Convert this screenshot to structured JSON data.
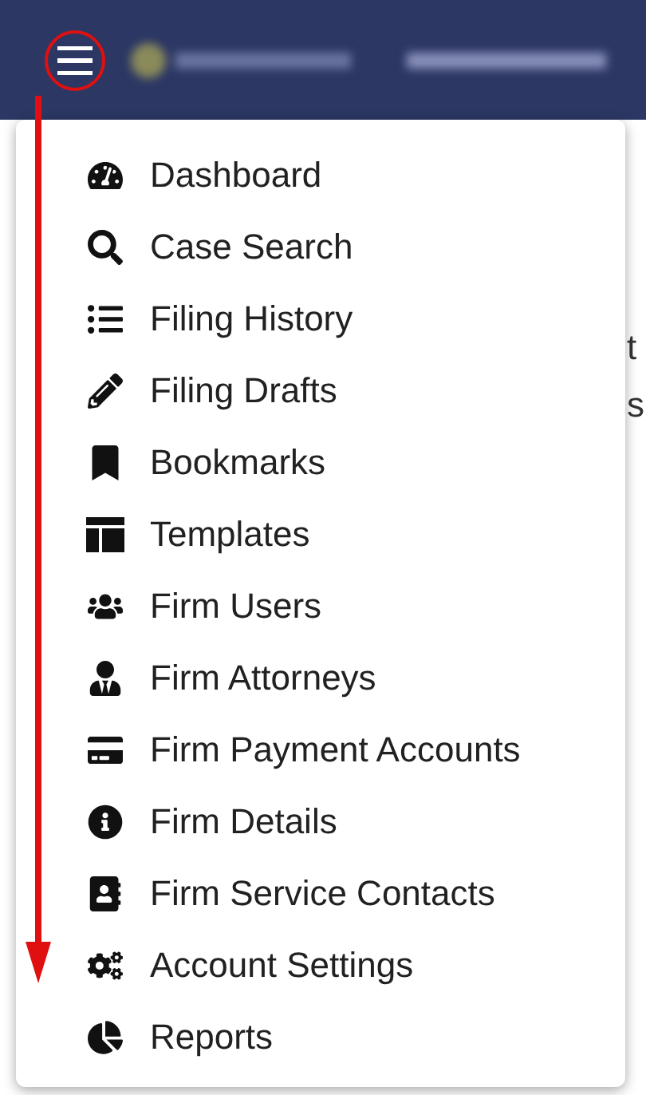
{
  "header": {
    "menu_highlighted": true
  },
  "menu": {
    "items": [
      {
        "label": "Dashboard"
      },
      {
        "label": "Case Search"
      },
      {
        "label": "Filing History"
      },
      {
        "label": "Filing Drafts"
      },
      {
        "label": "Bookmarks"
      },
      {
        "label": "Templates"
      },
      {
        "label": "Firm Users"
      },
      {
        "label": "Firm Attorneys"
      },
      {
        "label": "Firm Payment Accounts"
      },
      {
        "label": "Firm Details"
      },
      {
        "label": "Firm Service Contacts"
      },
      {
        "label": "Account Settings"
      },
      {
        "label": "Reports"
      }
    ]
  },
  "background_text": [
    "t",
    "s"
  ]
}
